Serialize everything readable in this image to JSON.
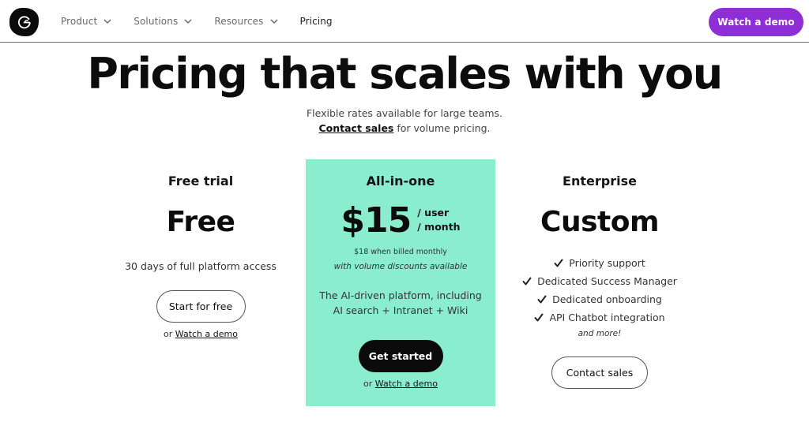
{
  "nav": {
    "logo_icon": "g-logo-icon",
    "items": [
      {
        "label": "Product",
        "has_dropdown": true
      },
      {
        "label": "Solutions",
        "has_dropdown": true
      },
      {
        "label": "Resources",
        "has_dropdown": true
      },
      {
        "label": "Pricing",
        "has_dropdown": false
      }
    ],
    "cta_label": "Watch a demo",
    "cta_color": "#8e2fd6"
  },
  "hero": {
    "title": "Pricing that scales with you",
    "subtitle_line1": "Flexible rates available for large teams.",
    "contact_link": "Contact sales",
    "subtitle_line2_rest": " for volume pricing."
  },
  "plans": {
    "free": {
      "name": "Free trial",
      "price": "Free",
      "description": "30 days of full platform access",
      "button_label": "Start for free",
      "or_text": "or ",
      "demo_link": "Watch a demo"
    },
    "all_in_one": {
      "name": "All-in-one",
      "price": "$15",
      "unit_line1": "/ user",
      "unit_line2": "/ month",
      "monthly_note": "$18 when billed monthly",
      "discount_note": "with volume discounts available",
      "description_line1": "The AI-driven platform, including",
      "description_line2": "AI search + Intranet + Wiki",
      "button_label": "Get started",
      "or_text": "or ",
      "demo_link": "Watch a demo",
      "background_color": "#8aedcd"
    },
    "enterprise": {
      "name": "Enterprise",
      "price": "Custom",
      "features": [
        "Priority support",
        "Dedicated Success Manager",
        "Dedicated onboarding",
        "API Chatbot integration"
      ],
      "more_text": "and more!",
      "button_label": "Contact sales"
    }
  }
}
